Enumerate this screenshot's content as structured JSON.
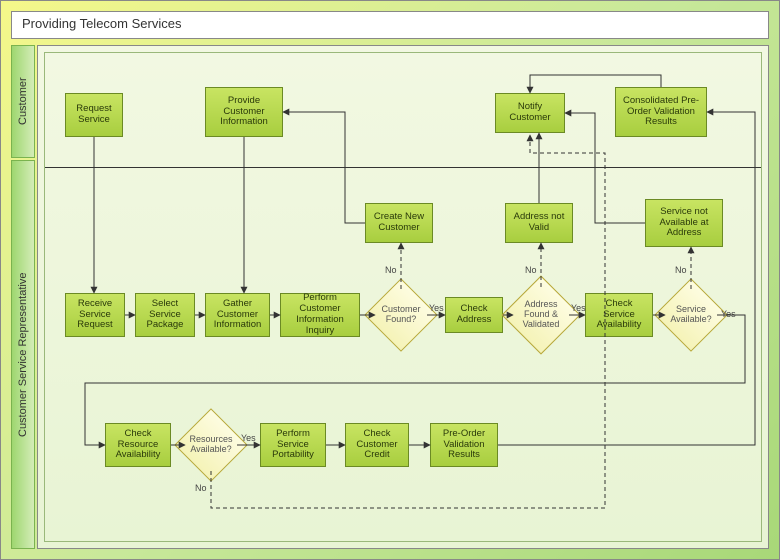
{
  "title": "Providing Telecom Services",
  "lanes": {
    "customer": "Customer",
    "csr": "Customer Service Representative"
  },
  "nodes": {
    "request_service": "Request Service",
    "provide_info": "Provide Customer Information",
    "notify_customer": "Notify Customer",
    "consolidated": "Consolidated Pre-Order Validation Results",
    "receive_request": "Receive Service Request",
    "select_package": "Select Service Package",
    "gather_info": "Gather Customer Information",
    "perform_inquiry": "Perform Customer Information Inquiry",
    "create_new": "Create New Customer",
    "customer_found": "Customer Found?",
    "check_address": "Check Address",
    "address_not_valid": "Address not Valid",
    "address_found": "Address Found & Validated",
    "check_service": "Check Service Availability",
    "service_not_avail": "Service not Available at Address",
    "service_available": "Service Available?",
    "check_resource": "Check Resource Availability",
    "resources_available": "Resources Available?",
    "perform_portability": "Perform Service Portability",
    "check_credit": "Check Customer Credit",
    "preorder_results": "Pre-Order Validation Results"
  },
  "labels": {
    "yes": "Yes",
    "no": "No"
  },
  "chart_data": {
    "type": "swimlane-flowchart",
    "title": "Providing Telecom Services",
    "lanes": [
      "Customer",
      "Customer Service Representative"
    ],
    "nodes": [
      {
        "id": "request_service",
        "lane": "Customer",
        "type": "process",
        "label": "Request Service"
      },
      {
        "id": "provide_info",
        "lane": "Customer",
        "type": "process",
        "label": "Provide Customer Information"
      },
      {
        "id": "notify_customer",
        "lane": "Customer",
        "type": "process",
        "label": "Notify Customer"
      },
      {
        "id": "consolidated",
        "lane": "Customer",
        "type": "process",
        "label": "Consolidated Pre-Order Validation Results"
      },
      {
        "id": "receive_request",
        "lane": "CSR",
        "type": "process",
        "label": "Receive Service Request"
      },
      {
        "id": "select_package",
        "lane": "CSR",
        "type": "process",
        "label": "Select Service Package"
      },
      {
        "id": "gather_info",
        "lane": "CSR",
        "type": "process",
        "label": "Gather Customer Information"
      },
      {
        "id": "perform_inquiry",
        "lane": "CSR",
        "type": "process",
        "label": "Perform Customer Information Inquiry"
      },
      {
        "id": "customer_found",
        "lane": "CSR",
        "type": "decision",
        "label": "Customer Found?"
      },
      {
        "id": "create_new",
        "lane": "CSR",
        "type": "process",
        "label": "Create New Customer"
      },
      {
        "id": "check_address",
        "lane": "CSR",
        "type": "process",
        "label": "Check Address"
      },
      {
        "id": "address_found",
        "lane": "CSR",
        "type": "decision",
        "label": "Address Found & Validated"
      },
      {
        "id": "address_not_valid",
        "lane": "CSR",
        "type": "process",
        "label": "Address not Valid"
      },
      {
        "id": "check_service",
        "lane": "CSR",
        "type": "process",
        "label": "Check Service Availability"
      },
      {
        "id": "service_available",
        "lane": "CSR",
        "type": "decision",
        "label": "Service Available?"
      },
      {
        "id": "service_not_avail",
        "lane": "CSR",
        "type": "process",
        "label": "Service not Available at Address"
      },
      {
        "id": "check_resource",
        "lane": "CSR",
        "type": "process",
        "label": "Check Resource Availability"
      },
      {
        "id": "resources_available",
        "lane": "CSR",
        "type": "decision",
        "label": "Resources Available?"
      },
      {
        "id": "perform_portability",
        "lane": "CSR",
        "type": "process",
        "label": "Perform Service Portability"
      },
      {
        "id": "check_credit",
        "lane": "CSR",
        "type": "process",
        "label": "Check Customer Credit"
      },
      {
        "id": "preorder_results",
        "lane": "CSR",
        "type": "process",
        "label": "Pre-Order Validation Results"
      }
    ],
    "edges": [
      {
        "from": "request_service",
        "to": "receive_request"
      },
      {
        "from": "receive_request",
        "to": "select_package"
      },
      {
        "from": "select_package",
        "to": "gather_info"
      },
      {
        "from": "provide_info",
        "to": "gather_info"
      },
      {
        "from": "gather_info",
        "to": "perform_inquiry"
      },
      {
        "from": "perform_inquiry",
        "to": "customer_found"
      },
      {
        "from": "customer_found",
        "to": "check_address",
        "label": "Yes"
      },
      {
        "from": "customer_found",
        "to": "create_new",
        "label": "No",
        "style": "dashed"
      },
      {
        "from": "create_new",
        "to": "provide_info"
      },
      {
        "from": "check_address",
        "to": "address_found"
      },
      {
        "from": "address_found",
        "to": "check_service",
        "label": "Yes"
      },
      {
        "from": "address_found",
        "to": "address_not_valid",
        "label": "No",
        "style": "dashed"
      },
      {
        "from": "address_not_valid",
        "to": "notify_customer"
      },
      {
        "from": "check_service",
        "to": "service_available"
      },
      {
        "from": "service_available",
        "to": "check_resource",
        "label": "Yes"
      },
      {
        "from": "service_available",
        "to": "service_not_avail",
        "label": "No",
        "style": "dashed"
      },
      {
        "from": "service_not_avail",
        "to": "notify_customer"
      },
      {
        "from": "check_resource",
        "to": "resources_available"
      },
      {
        "from": "resources_available",
        "to": "perform_portability",
        "label": "Yes"
      },
      {
        "from": "resources_available",
        "to": "notify_customer",
        "label": "No",
        "style": "dashed"
      },
      {
        "from": "perform_portability",
        "to": "check_credit"
      },
      {
        "from": "check_credit",
        "to": "preorder_results"
      },
      {
        "from": "preorder_results",
        "to": "consolidated"
      },
      {
        "from": "consolidated",
        "to": "notify_customer"
      }
    ]
  }
}
